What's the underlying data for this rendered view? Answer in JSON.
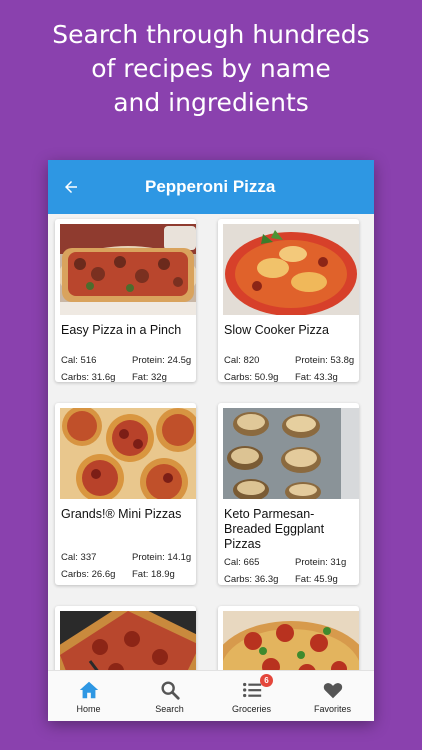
{
  "promo": {
    "line1": "Search through hundreds",
    "line2": "of recipes by name",
    "line3": "and ingredients"
  },
  "appbar": {
    "title": "Pepperoni Pizza",
    "back_icon": "arrow-left-icon",
    "color": "#2e97e3"
  },
  "recipes": [
    {
      "title": "Easy Pizza in a Pinch",
      "cal": "Cal: 516",
      "protein": "Protein: 24.5g",
      "carbs": "Carbs: 31.6g",
      "fat": "Fat: 32g"
    },
    {
      "title": "Slow Cooker Pizza",
      "cal": "Cal: 820",
      "protein": "Protein: 53.8g",
      "carbs": "Carbs: 50.9g",
      "fat": "Fat: 43.3g"
    },
    {
      "title": "Grands!® Mini Pizzas",
      "cal": "Cal: 337",
      "protein": "Protein: 14.1g",
      "carbs": "Carbs: 26.6g",
      "fat": "Fat: 18.9g"
    },
    {
      "title": "Keto Parmesan-Breaded Eggplant Pizzas",
      "cal": "Cal: 665",
      "protein": "Protein: 31g",
      "carbs": "Carbs: 36.3g",
      "fat": "Fat: 45.9g"
    }
  ],
  "nav": {
    "items": [
      {
        "label": "Home",
        "icon": "home-icon",
        "active": true
      },
      {
        "label": "Search",
        "icon": "search-icon"
      },
      {
        "label": "Groceries",
        "icon": "list-icon",
        "badge": "6"
      },
      {
        "label": "Favorites",
        "icon": "heart-icon"
      }
    ],
    "active_color": "#2e97e3",
    "badge_color": "#e4463b"
  }
}
